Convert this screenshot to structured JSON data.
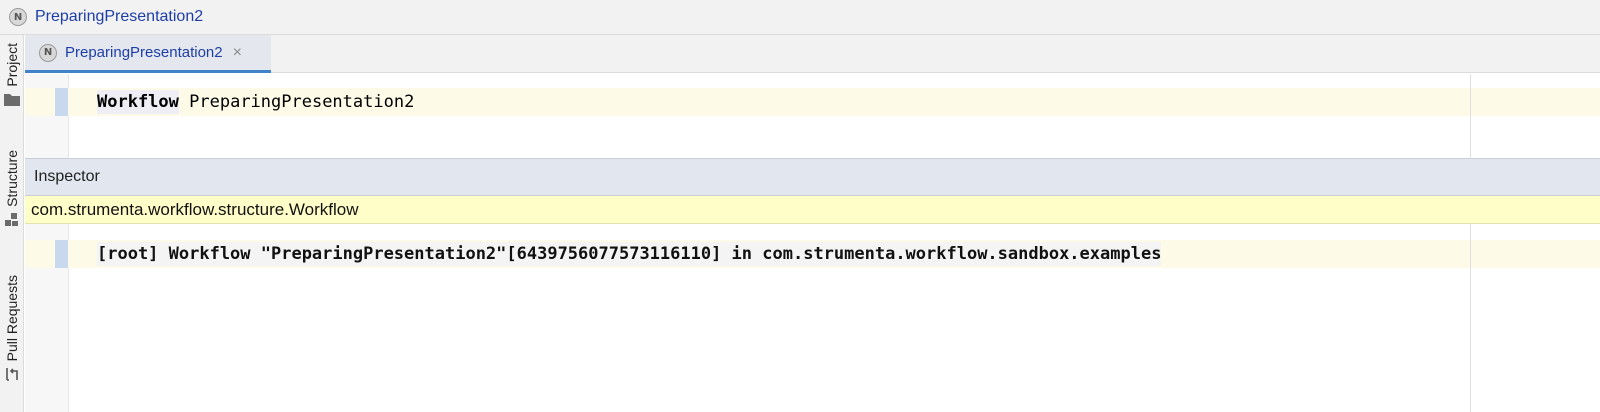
{
  "navbar": {
    "node_icon_letter": "N",
    "title": "PreparingPresentation2"
  },
  "tool_strip": {
    "items": [
      {
        "label": "Project",
        "icon": "folder-icon"
      },
      {
        "label": "Structure",
        "icon": "structure-icon"
      },
      {
        "label": "Pull Requests",
        "icon": "pull-request-icon"
      }
    ]
  },
  "tabs": [
    {
      "label": "PreparingPresentation2",
      "icon_letter": "N",
      "close": "×",
      "active": true
    }
  ],
  "editor": {
    "keyword": "Workflow",
    "name": "PreparingPresentation2"
  },
  "inspector": {
    "title": "Inspector",
    "concept": "com.strumenta.workflow.structure.Workflow",
    "line": "[root] Workflow \"PreparingPresentation2\"[6439756077573116110] in com.strumenta.workflow.sandbox.examples"
  },
  "colors": {
    "accent": "#4083c9",
    "link": "#1d3ea8",
    "concept_bg": "#fffdc8",
    "inspector_header_bg": "#e2e6ef"
  }
}
